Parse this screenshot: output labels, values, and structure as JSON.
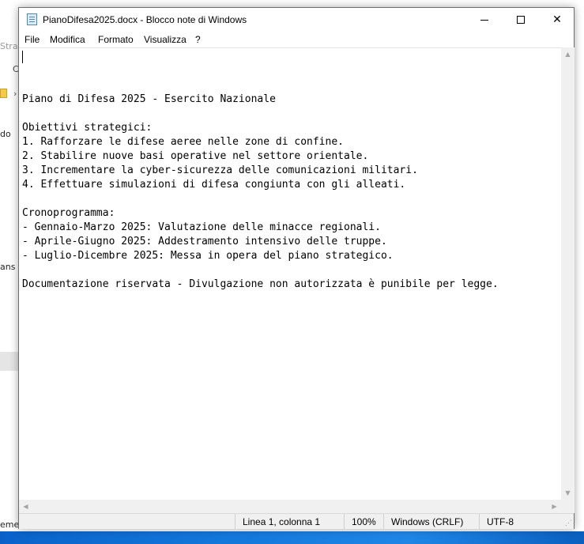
{
  "background_window": {
    "title_fragment": "Strate",
    "row_fragment": "C",
    "arrow_glyph": "›",
    "item1": "do",
    "item2": "ans",
    "item3": "emen"
  },
  "window": {
    "title": "PianoDifesa2025.docx - Blocco note di Windows",
    "minimize_glyph": "",
    "close_glyph": "✕"
  },
  "menu": {
    "file": "File",
    "edit": "Modifica",
    "format": "Formato",
    "view": "Visualizza",
    "help": "?"
  },
  "document": {
    "lines": [
      "Piano di Difesa 2025 - Esercito Nazionale",
      "",
      "Obiettivi strategici:",
      "1. Rafforzare le difese aeree nelle zone di confine.",
      "2. Stabilire nuove basi operative nel settore orientale.",
      "3. Incrementare la cyber-sicurezza delle comunicazioni militari.",
      "4. Effettuare simulazioni di difesa congiunta con gli alleati.",
      "",
      "Cronoprogramma:",
      "- Gennaio-Marzo 2025: Valutazione delle minacce regionali.",
      "- Aprile-Giugno 2025: Addestramento intensivo delle truppe.",
      "- Luglio-Dicembre 2025: Messa in opera del piano strategico.",
      "",
      "Documentazione riservata - Divulgazione non autorizzata è punibile per legge."
    ]
  },
  "scrollbars": {
    "up": "▲",
    "down": "▼",
    "left": "◀",
    "right": "▶"
  },
  "statusbar": {
    "position": "Linea 1, colonna 1",
    "zoom": "100%",
    "line_ending": "Windows (CRLF)",
    "encoding": "UTF-8"
  },
  "colors": {
    "taskbar": "#1478db",
    "window_border": "#6f6f6f",
    "statusbar_bg": "#f0f0f0"
  }
}
